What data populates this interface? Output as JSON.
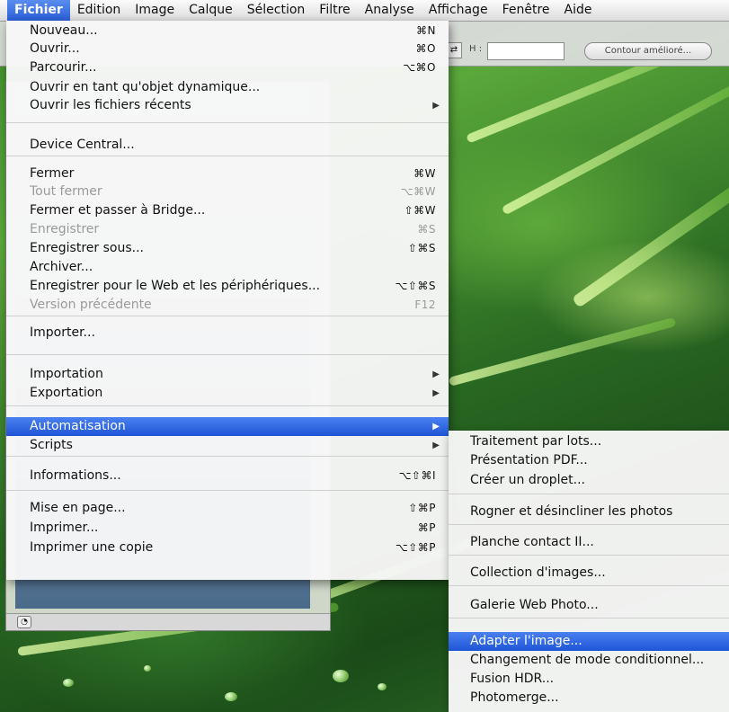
{
  "menubar": {
    "items": [
      "Fichier",
      "Edition",
      "Image",
      "Calque",
      "Sélection",
      "Filtre",
      "Analyse",
      "Affichage",
      "Fenêtre",
      "Aide"
    ]
  },
  "options_bar": {
    "h_label": "H :",
    "refine_button": "Contour amélioré..."
  },
  "file_menu": {
    "items": [
      {
        "label": "Nouveau...",
        "shortcut": "⌘N"
      },
      {
        "label": "Ouvrir...",
        "shortcut": "⌘O"
      },
      {
        "label": "Parcourir...",
        "shortcut": "⌥⌘O"
      },
      {
        "label": "Ouvrir en tant qu'objet dynamique...",
        "shortcut": ""
      },
      {
        "label": "Ouvrir les fichiers récents",
        "shortcut": "",
        "submenu": true
      },
      {
        "label": "Device Central...",
        "shortcut": ""
      },
      {
        "label": "Fermer",
        "shortcut": "⌘W"
      },
      {
        "label": "Tout fermer",
        "shortcut": "⌥⌘W",
        "disabled": true
      },
      {
        "label": "Fermer et passer à Bridge...",
        "shortcut": "⇧⌘W"
      },
      {
        "label": "Enregistrer",
        "shortcut": "⌘S",
        "disabled": true
      },
      {
        "label": "Enregistrer sous...",
        "shortcut": "⇧⌘S"
      },
      {
        "label": "Archiver...",
        "shortcut": ""
      },
      {
        "label": "Enregistrer pour le Web et les périphériques...",
        "shortcut": "⌥⇧⌘S"
      },
      {
        "label": "Version précédente",
        "shortcut": "F12",
        "disabled": true
      },
      {
        "label": "Importer...",
        "shortcut": ""
      },
      {
        "label": "Importation",
        "shortcut": "",
        "submenu": true
      },
      {
        "label": "Exportation",
        "shortcut": "",
        "submenu": true
      },
      {
        "label": "Automatisation",
        "shortcut": "",
        "submenu": true,
        "highlighted": true
      },
      {
        "label": "Scripts",
        "shortcut": "",
        "submenu": true
      },
      {
        "label": "Informations...",
        "shortcut": "⌥⇧⌘I"
      },
      {
        "label": "Mise en page...",
        "shortcut": "⇧⌘P"
      },
      {
        "label": "Imprimer...",
        "shortcut": "⌘P"
      },
      {
        "label": "Imprimer une copie",
        "shortcut": "⌥⇧⌘P"
      }
    ]
  },
  "automate_submenu": {
    "items": [
      {
        "label": "Traitement par lots..."
      },
      {
        "label": "Présentation PDF..."
      },
      {
        "label": "Créer un droplet..."
      },
      {
        "label": "Rogner et désincliner les photos"
      },
      {
        "label": "Planche contact II..."
      },
      {
        "label": "Collection d'images..."
      },
      {
        "label": "Galerie Web Photo..."
      },
      {
        "label": "Adapter l'image...",
        "highlighted": true
      },
      {
        "label": "Changement de mode conditionnel..."
      },
      {
        "label": "Fusion HDR..."
      },
      {
        "label": "Photomerge..."
      }
    ]
  },
  "colors": {
    "highlight": "#2a5ed8",
    "menu_bg": "#f7f7f7",
    "disabled_text": "#9a9a9a"
  }
}
